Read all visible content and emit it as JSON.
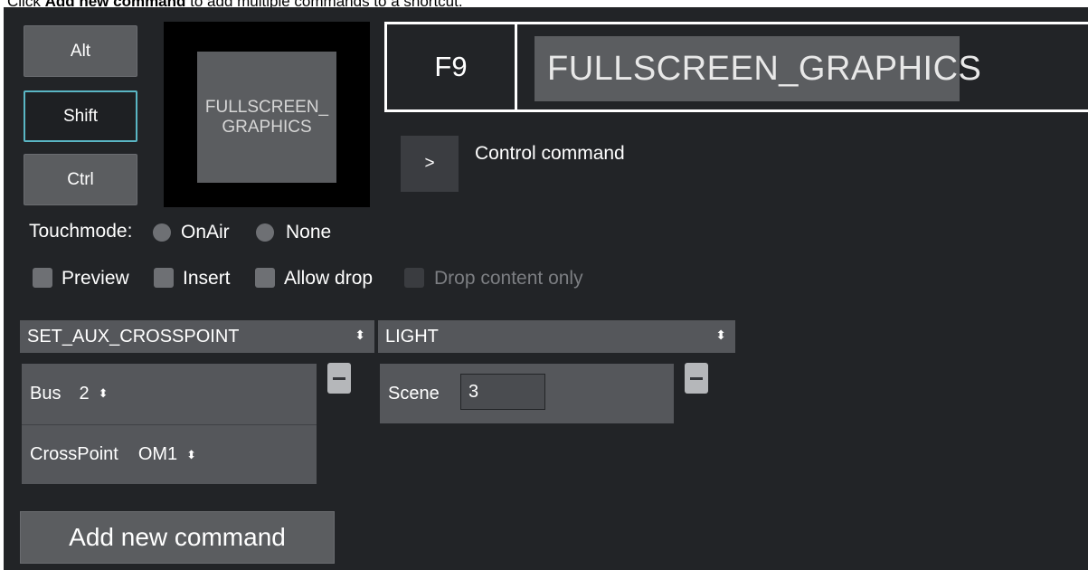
{
  "instruction": {
    "prefix": "Click ",
    "bold": "Add new command",
    "suffix": " to add multiple commands to a shortcut."
  },
  "modifiers": {
    "alt": "Alt",
    "shift": "Shift",
    "ctrl": "Ctrl"
  },
  "preview": {
    "text": "FULLSCREEN_\nGRAPHICS"
  },
  "shortcut": {
    "key": "F9",
    "name": "FULLSCREEN_GRAPHICS"
  },
  "control": {
    "button": ">",
    "label": "Control command"
  },
  "touchmode": {
    "label": "Touchmode:",
    "options": [
      "OnAir",
      "None"
    ]
  },
  "options": {
    "preview": "Preview",
    "insert": "Insert",
    "allow_drop": "Allow drop",
    "drop_content_only": "Drop content only"
  },
  "commands": [
    {
      "name": "SET_AUX_CROSSPOINT",
      "params": [
        {
          "label": "Bus",
          "value": "2"
        },
        {
          "label": "CrossPoint",
          "value": "OM1"
        }
      ]
    },
    {
      "name": "LIGHT",
      "params": [
        {
          "label": "Scene",
          "value": "3"
        }
      ]
    }
  ],
  "add_command": "Add new command",
  "spin_glyph": "⬍"
}
